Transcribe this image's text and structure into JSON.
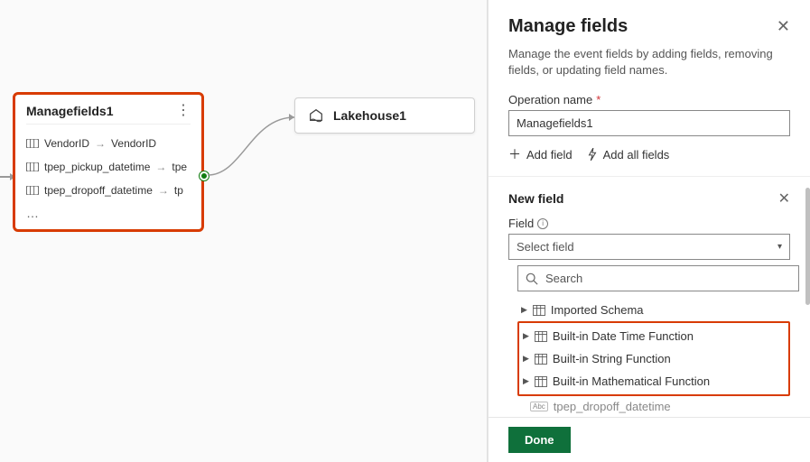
{
  "panel": {
    "title": "Manage fields",
    "description": "Manage the event fields by adding fields, removing fields, or updating field names.",
    "operation_name_label": "Operation name",
    "operation_name_value": "Managefields1",
    "add_field_label": "Add field",
    "add_all_fields_label": "Add all fields",
    "new_field_label": "New field",
    "field_label": "Field",
    "select_placeholder": "Select field",
    "search_placeholder": "Search",
    "tree": {
      "imported_schema": "Imported Schema",
      "datetime_fn": "Built-in Date Time Function",
      "string_fn": "Built-in String Function",
      "math_fn": "Built-in Mathematical Function",
      "leaf": "tpep_dropoff_datetime"
    },
    "abc_label": "Abc",
    "done_label": "Done"
  },
  "nodes": {
    "managefields": {
      "title": "Managefields1",
      "rows": [
        {
          "from": "VendorID",
          "to": "VendorID"
        },
        {
          "from": "tpep_pickup_datetime",
          "to": "tpe"
        },
        {
          "from": "tpep_dropoff_datetime",
          "to": "tp"
        }
      ],
      "ellipsis": "…"
    },
    "lakehouse": {
      "title": "Lakehouse1"
    }
  }
}
